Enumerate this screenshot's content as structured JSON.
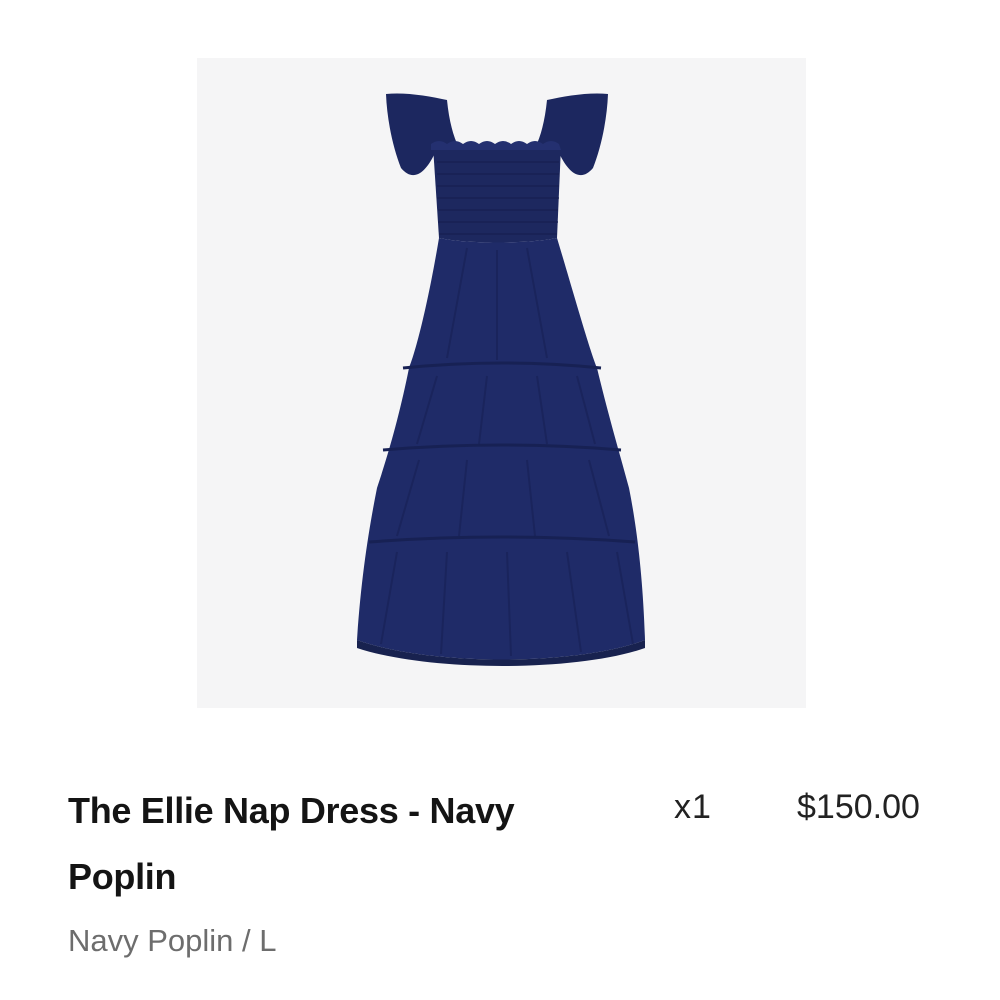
{
  "line_item": {
    "image_alt": "The Ellie Nap Dress - Navy Poplin",
    "title": "The Ellie Nap Dress - Navy Poplin",
    "variant": "Navy Poplin / L",
    "quantity": "x1",
    "price": "$150.00"
  },
  "colors": {
    "dress": "#1f2b68",
    "image_background": "#f5f5f6",
    "title_text": "#141414",
    "muted_text": "#6d6d6d"
  }
}
